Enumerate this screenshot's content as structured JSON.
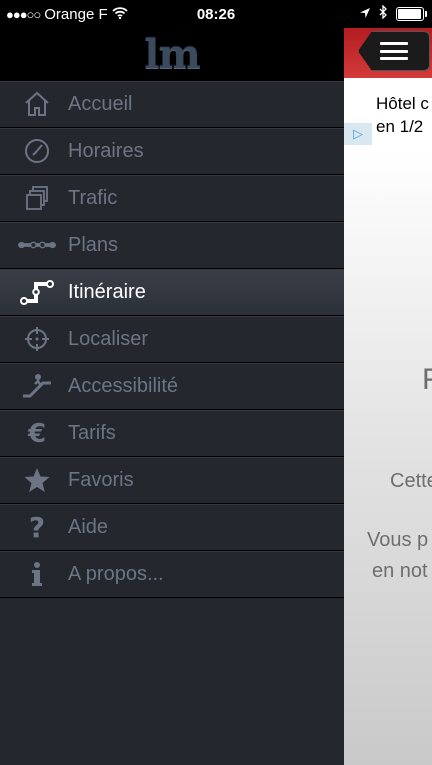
{
  "status_bar": {
    "signal": "●●●○○",
    "carrier": "Orange F",
    "time": "08:26",
    "battery_level": 0.9
  },
  "menu": {
    "logo": "lm",
    "items": [
      {
        "label": "Accueil",
        "icon": "home-icon",
        "active": false
      },
      {
        "label": "Horaires",
        "icon": "clock-icon",
        "active": false
      },
      {
        "label": "Trafic",
        "icon": "traffic-icon",
        "active": false
      },
      {
        "label": "Plans",
        "icon": "map-line-icon",
        "active": false
      },
      {
        "label": "Itinéraire",
        "icon": "route-icon",
        "active": true
      },
      {
        "label": "Localiser",
        "icon": "crosshair-icon",
        "active": false
      },
      {
        "label": "Accessibilité",
        "icon": "escalator-icon",
        "active": false
      },
      {
        "label": "Tarifs",
        "icon": "euro-icon",
        "active": false
      },
      {
        "label": "Favoris",
        "icon": "star-icon",
        "active": false
      },
      {
        "label": "Aide",
        "icon": "question-icon",
        "active": false
      },
      {
        "label": "A propos...",
        "icon": "info-icon",
        "active": false
      }
    ]
  },
  "content": {
    "ad_line1": "Hôtel c",
    "ad_line2": "en 1/2",
    "heading_fragment": "F",
    "text_line1": "Cette",
    "text_line2": "Vous p",
    "text_line3": "en not"
  },
  "colors": {
    "menu_bg": "#24272e",
    "menu_text": "#6d7585",
    "active_text": "#ffffff",
    "header_red": "#c42a2e"
  }
}
